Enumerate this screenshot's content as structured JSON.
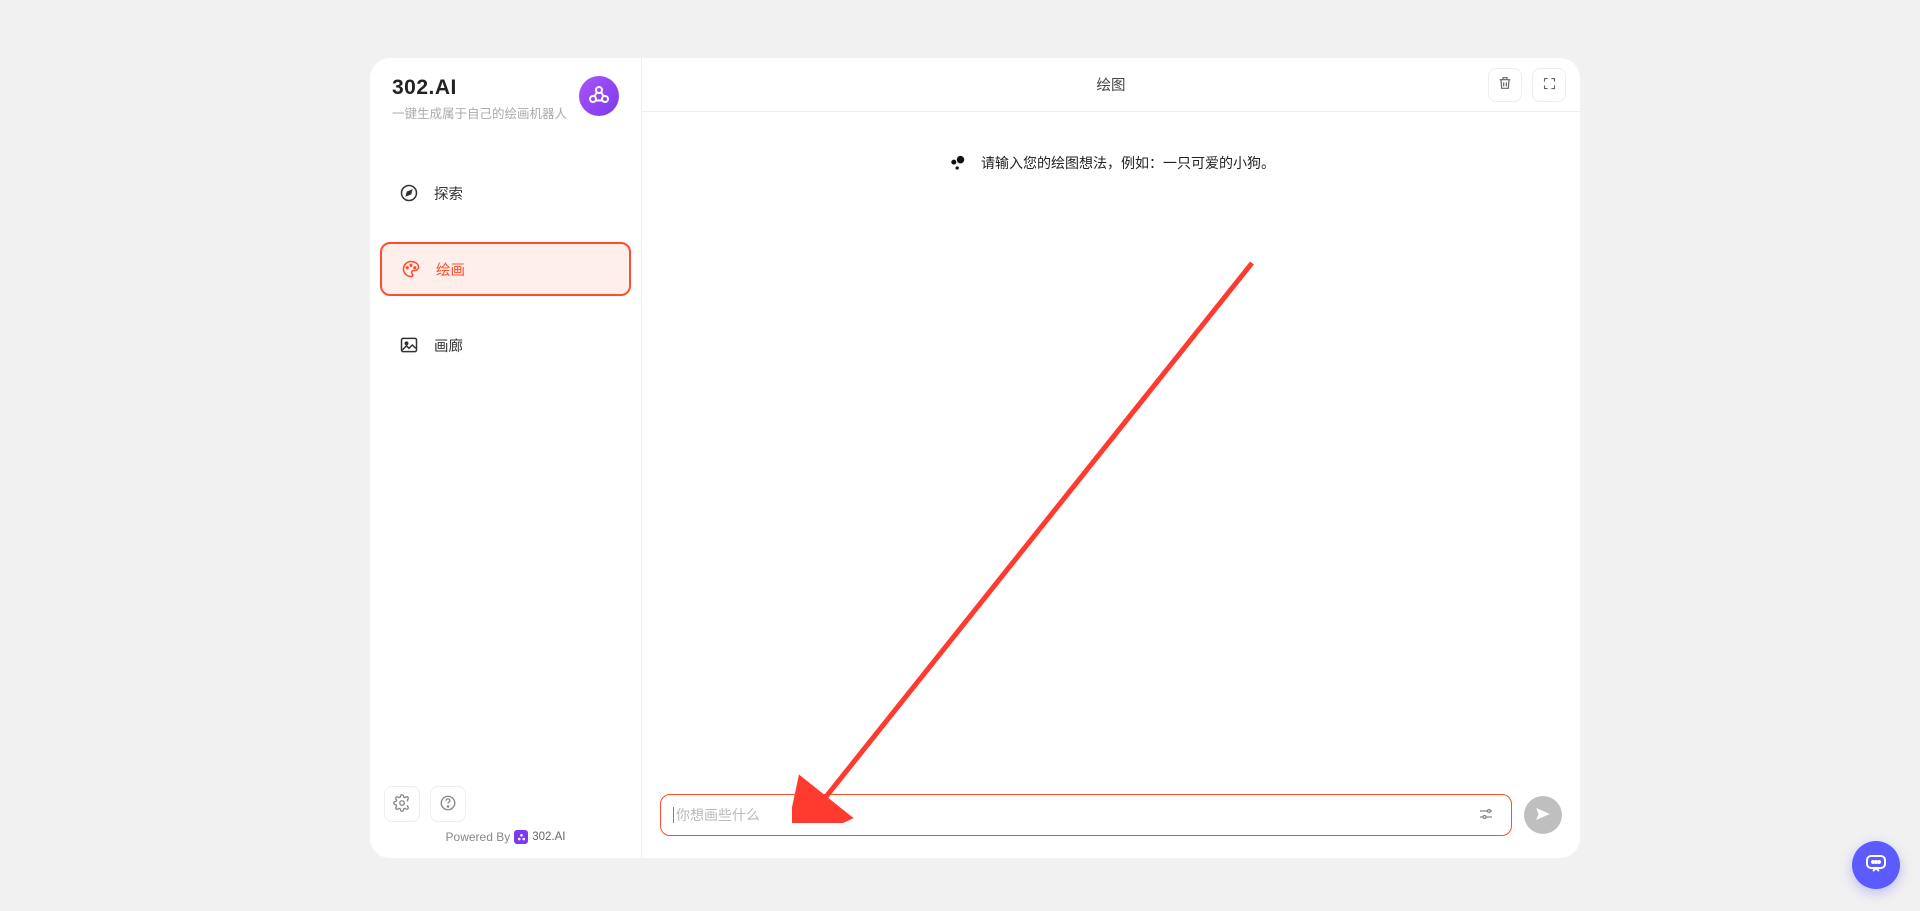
{
  "brand": {
    "title": "302.AI",
    "subtitle": "一键生成属于自己的绘画机器人"
  },
  "sidebar": {
    "items": [
      {
        "label": "探索",
        "icon": "compass-icon",
        "active": false
      },
      {
        "label": "绘画",
        "icon": "palette-icon",
        "active": true
      },
      {
        "label": "画廊",
        "icon": "image-icon",
        "active": false
      }
    ]
  },
  "footer": {
    "powered_text": "Powered By",
    "powered_brand": "302.AI"
  },
  "header": {
    "title": "绘图"
  },
  "hint": {
    "text": "请输入您的绘图想法，例如：一只可爱的小狗。"
  },
  "input": {
    "placeholder": "你想画些什么"
  }
}
